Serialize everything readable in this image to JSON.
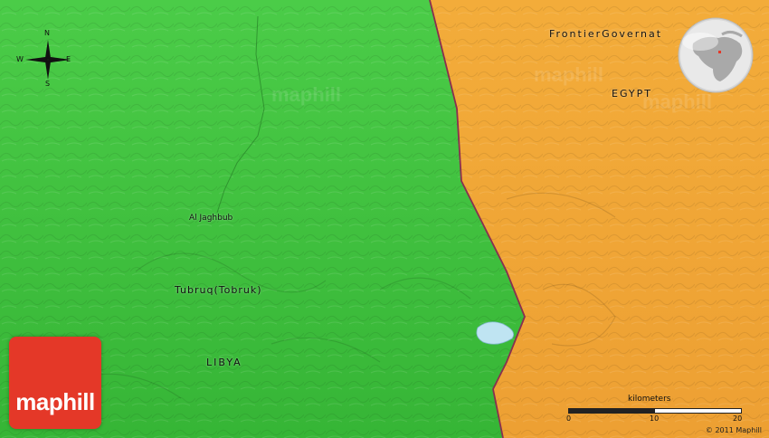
{
  "map": {
    "countries": [
      {
        "name": "LIBYA",
        "color": "#3fc43f"
      },
      {
        "name": "EGYPT",
        "color": "#f0a836"
      }
    ],
    "labels": {
      "frontier": "FrontierGovernat",
      "egypt": "EGYPT",
      "libya": "LIBYA",
      "tubruq": "Tubruq(Tobruk)",
      "jaghbub": "Al Jaghbub"
    },
    "lake_color": "#bfe4f2",
    "border_color": "#8a2f4f"
  },
  "compass": {
    "n": "N",
    "s": "S",
    "e": "E",
    "w": "W"
  },
  "globe": {
    "icon": "globe-locator-icon"
  },
  "logo": {
    "text": "maphill",
    "color": "#e43828"
  },
  "scale": {
    "title": "kilometers",
    "ticks": [
      "0",
      "10",
      "20"
    ]
  },
  "copyright": "© 2011 Maphill",
  "watermark": "maphill"
}
